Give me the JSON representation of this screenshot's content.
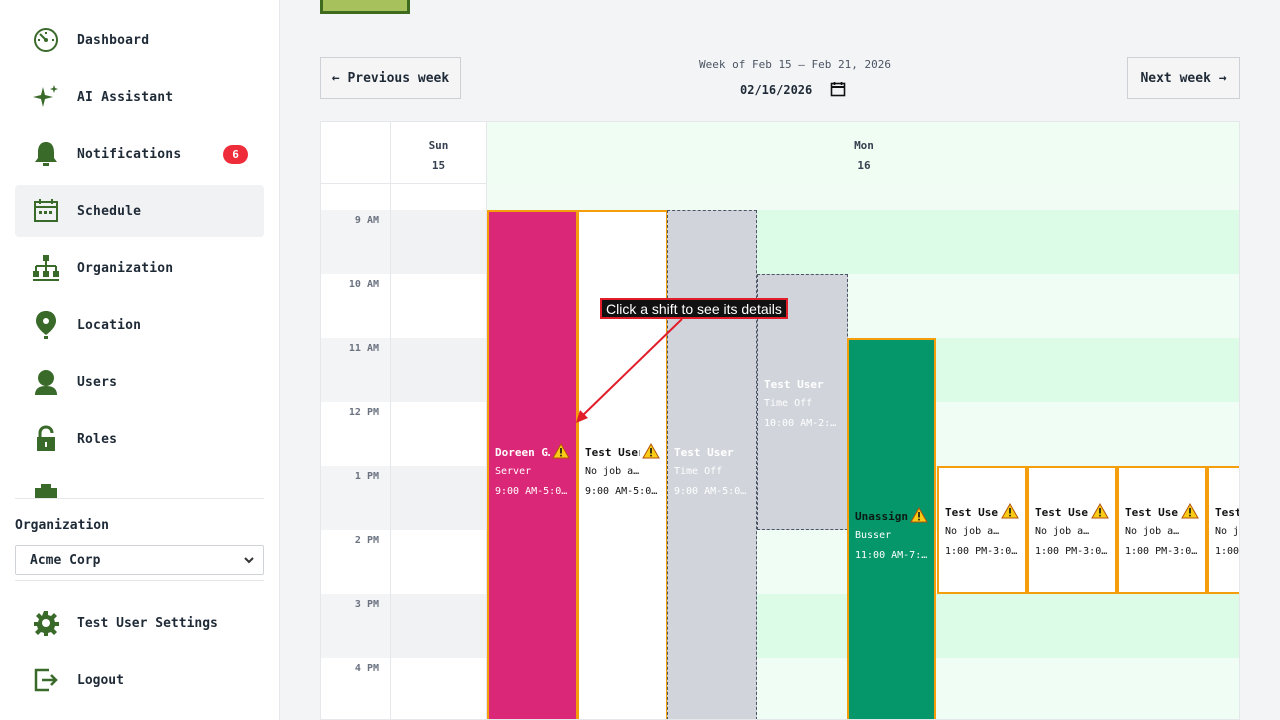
{
  "sidebar": {
    "items": [
      {
        "label": "Dashboard",
        "icon": "dashboard-icon"
      },
      {
        "label": "AI Assistant",
        "icon": "sparkle-icon"
      },
      {
        "label": "Notifications",
        "icon": "bell-icon",
        "badge": "6"
      },
      {
        "label": "Schedule",
        "icon": "calendar-icon",
        "active": true
      },
      {
        "label": "Organization",
        "icon": "org-chart-icon"
      },
      {
        "label": "Location",
        "icon": "map-pin-icon"
      },
      {
        "label": "Users",
        "icon": "user-icon"
      },
      {
        "label": "Roles",
        "icon": "lock-icon"
      }
    ],
    "org_label": "Organization",
    "org_select_value": "Acme Corp",
    "settings_label": "Test User Settings",
    "logout_label": "Logout"
  },
  "toolbar": {
    "prev_label": "← Previous week",
    "next_label": "Next week →",
    "week_title": "Week of Feb 15 – Feb 21, 2026",
    "date_value": "02/16/2026"
  },
  "calendar": {
    "days": [
      {
        "name": "Sun",
        "num": "15"
      },
      {
        "name": "Mon",
        "num": "16"
      }
    ],
    "hours": [
      "9 AM",
      "10 AM",
      "11 AM",
      "12 PM",
      "1 PM",
      "2 PM",
      "3 PM",
      "4 PM"
    ],
    "shifts": [
      {
        "name": "Doreen G…",
        "role": "Server",
        "time": "9:00 AM-5:0…",
        "warning": true
      },
      {
        "name": "Test User",
        "role": "No job a…",
        "time": "9:00 AM-5:0…",
        "warning": true
      },
      {
        "name": "Test User",
        "role": "Time Off",
        "time": "9:00 AM-5:0…",
        "warning": false
      },
      {
        "name": "Test User",
        "role": "Time Off",
        "time": "10:00 AM-2:…",
        "warning": false
      },
      {
        "name": "Unassign…",
        "role": "Busser",
        "time": "11:00 AM-7:…",
        "warning": true
      },
      {
        "name": "Test User",
        "role": "No job a…",
        "time": "1:00 PM-3:0…",
        "warning": true
      },
      {
        "name": "Test User",
        "role": "No job a…",
        "time": "1:00 PM-3:0…",
        "warning": true
      },
      {
        "name": "Test User",
        "role": "No job a…",
        "time": "1:00 PM-3:0…",
        "warning": true
      },
      {
        "name": "Test",
        "role": "No jo",
        "time": "1:00",
        "warning": false
      }
    ]
  },
  "callout": "Click a shift to see its details",
  "colors": {
    "accent_green": "#059669",
    "shift_pink": "#db2777",
    "warning": "#f59e0b",
    "badge_red": "#ef2d3a"
  }
}
